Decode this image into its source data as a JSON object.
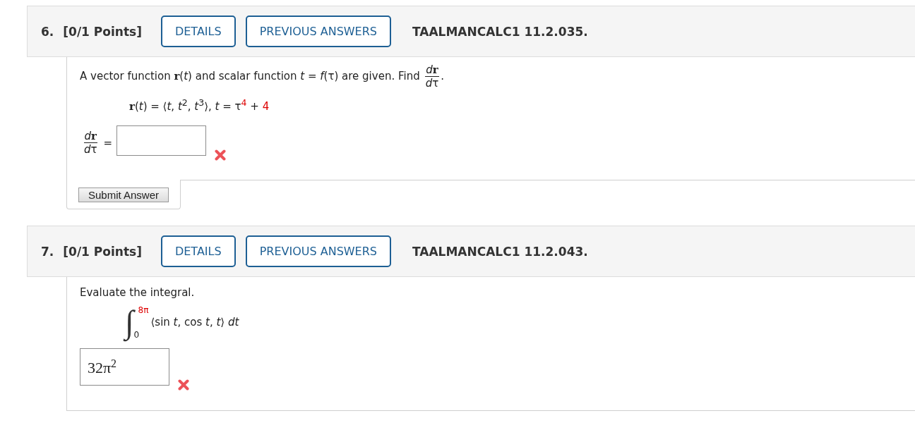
{
  "questions": [
    {
      "number": "6.",
      "points": "[0/1 Points]",
      "buttons": [
        "DETAILS",
        "PREVIOUS ANSWERS"
      ],
      "code": "TAALMANCALC1 11.2.035.",
      "prompt": [
        {
          "kind": "text",
          "text": "A vector function **r**(*t*) and scalar function *t* = *f*(τ) are given. Find"
        },
        {
          "kind": "fraction",
          "numerator": [
            "*d*",
            "**r**"
          ],
          "denominator": [
            "*d*",
            "τ"
          ]
        },
        {
          "kind": "text",
          "text": "."
        }
      ],
      "math": {
        "kind": "equation",
        "segments": [
          {
            "kind": "text",
            "text": "**r**(*t*) = ⟨*t*, *t*$^{2}$, *t*$^{3}$⟩, *t* = τ"
          },
          {
            "kind": "value",
            "text": "$^{4}$"
          },
          {
            "kind": "text",
            "text": " + "
          },
          {
            "kind": "value",
            "text": "4"
          }
        ]
      },
      "answer": {
        "kind": "input",
        "label": [
          {
            "kind": "fraction",
            "numerator": [
              "*d*",
              "**r**"
            ],
            "denominator": [
              "*d*",
              "τ"
            ]
          },
          {
            "kind": "text",
            "text": "="
          }
        ],
        "correct": false
      },
      "submit_button": "Submit Answer"
    },
    {
      "number": "7.",
      "points": "[0/1 Points]",
      "buttons": [
        "DETAILS",
        "PREVIOUS ANSWERS"
      ],
      "code": "TAALMANCALC1 11.2.043.",
      "prompt": [
        {
          "kind": "text",
          "text": "Evaluate the integral."
        }
      ],
      "math": {
        "kind": "integral",
        "sign": "∫",
        "upper_limit": {
          "kind": "value",
          "text": "8π"
        },
        "lower_limit": {
          "kind": "text",
          "text": "0"
        },
        "integrand": "⟨sin *t*, cos *t*, *t*⟩ *dt*"
      },
      "answer": {
        "kind": "box",
        "value": "32π$^{2}$",
        "correct": false
      }
    }
  ]
}
